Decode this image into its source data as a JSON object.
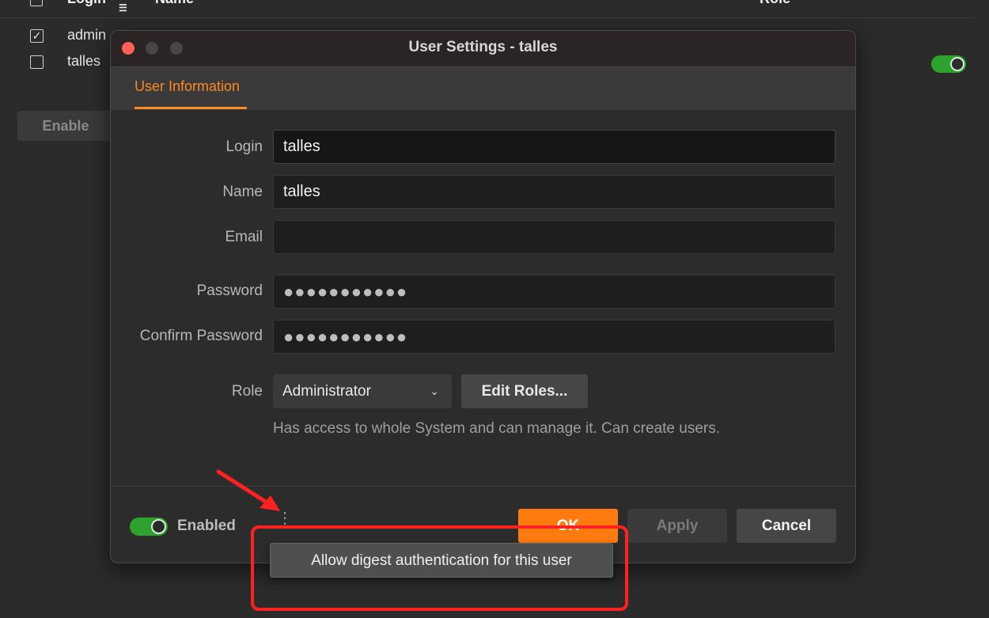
{
  "background": {
    "header": {
      "col_login": "Login",
      "col_name": "Name",
      "col_role": "Role"
    },
    "rows": [
      {
        "login": "admin",
        "checked": true
      },
      {
        "login": "talles",
        "checked": false
      }
    ],
    "enable_button": "Enable"
  },
  "dialog": {
    "title": "User Settings - talles",
    "tab": "User Information",
    "fields": {
      "login": {
        "label": "Login",
        "value": "talles"
      },
      "name": {
        "label": "Name",
        "value": "talles"
      },
      "email": {
        "label": "Email",
        "value": ""
      },
      "password": {
        "label": "Password",
        "value": "●●●●●●●●●●●"
      },
      "confirm_password": {
        "label": "Confirm Password",
        "value": "●●●●●●●●●●●"
      }
    },
    "role": {
      "label": "Role",
      "selected": "Administrator",
      "edit_button": "Edit Roles...",
      "description": "Has access to whole System and can manage it. Can create users."
    },
    "footer": {
      "enabled_label": "Enabled",
      "more_icon": "⋮",
      "ok_label": "OK",
      "apply_label": "Apply",
      "cancel_label": "Cancel"
    },
    "popup_menu": {
      "items": [
        "Allow digest authentication for this user"
      ]
    }
  },
  "colors": {
    "accent": "#ff7a0f",
    "toggle_on": "#2fa12f",
    "annotation": "#ff2020"
  }
}
